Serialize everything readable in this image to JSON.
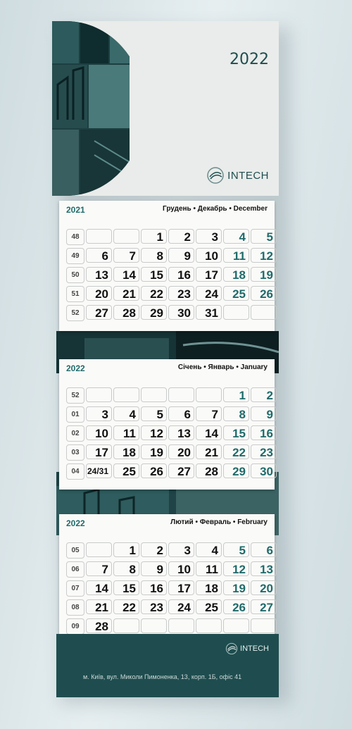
{
  "header": {
    "year": "2022",
    "brand": "INTECH"
  },
  "footer": {
    "address": "м. Київ, вул. Миколи Пимоненка, 13, корп. 1Б, офіс 41",
    "brand": "INTECH"
  },
  "months": [
    {
      "year": "2021",
      "title": "Грудень • Декабрь • December",
      "weeks": [
        "48",
        "49",
        "50",
        "51",
        "52"
      ],
      "rows": [
        [
          "",
          "",
          "1",
          "2",
          "3",
          "4",
          "5"
        ],
        [
          "6",
          "7",
          "8",
          "9",
          "10",
          "11",
          "12"
        ],
        [
          "13",
          "14",
          "15",
          "16",
          "17",
          "18",
          "19"
        ],
        [
          "20",
          "21",
          "22",
          "23",
          "24",
          "25",
          "26"
        ],
        [
          "27",
          "28",
          "29",
          "30",
          "31",
          "",
          ""
        ]
      ]
    },
    {
      "year": "2022",
      "title": "Січень • Январь • January",
      "weeks": [
        "52",
        "01",
        "02",
        "03",
        "04"
      ],
      "rows": [
        [
          "",
          "",
          "",
          "",
          "",
          "1",
          "2"
        ],
        [
          "3",
          "4",
          "5",
          "6",
          "7",
          "8",
          "9"
        ],
        [
          "10",
          "11",
          "12",
          "13",
          "14",
          "15",
          "16"
        ],
        [
          "17",
          "18",
          "19",
          "20",
          "21",
          "22",
          "23"
        ],
        [
          "24/31",
          "25",
          "26",
          "27",
          "28",
          "29",
          "30"
        ]
      ]
    },
    {
      "year": "2022",
      "title": "Лютий • Февраль • February",
      "weeks": [
        "05",
        "06",
        "07",
        "08",
        "09"
      ],
      "rows": [
        [
          "",
          "1",
          "2",
          "3",
          "4",
          "5",
          "6"
        ],
        [
          "7",
          "8",
          "9",
          "10",
          "11",
          "12",
          "13"
        ],
        [
          "14",
          "15",
          "16",
          "17",
          "18",
          "19",
          "20"
        ],
        [
          "21",
          "22",
          "23",
          "24",
          "25",
          "26",
          "27"
        ],
        [
          "28",
          "",
          "",
          "",
          "",
          "",
          ""
        ]
      ]
    }
  ]
}
